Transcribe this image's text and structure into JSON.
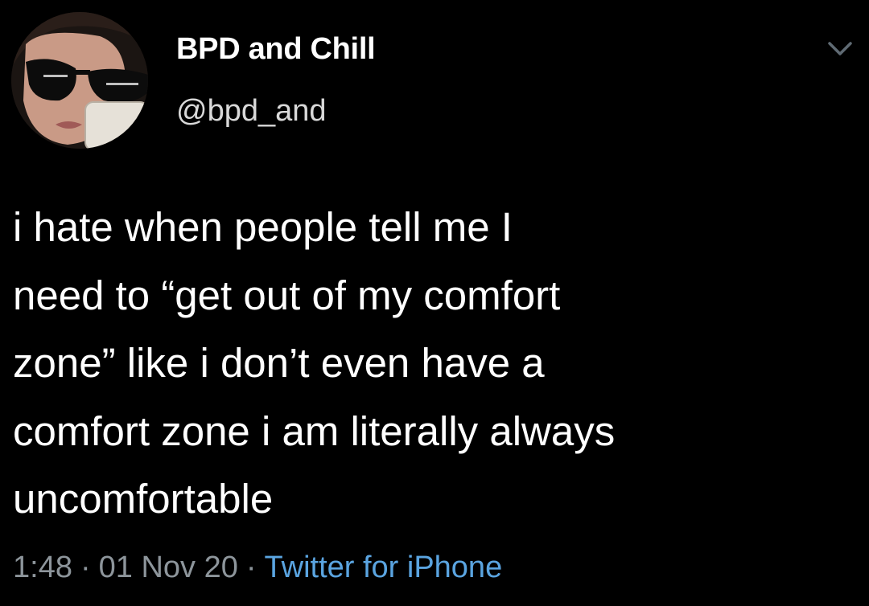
{
  "tweet": {
    "author": {
      "display_name": "BPD and Chill",
      "handle": "@bpd_and",
      "avatar_icon": "profile-photo"
    },
    "body_lines": [
      "i hate when people tell me I",
      "need to “get out of my comfort",
      "zone” like i don’t even have a",
      "comfort zone i am literally always",
      "uncomfortable"
    ],
    "meta": {
      "time": "1:48",
      "separator": "·",
      "date": "01 Nov 20",
      "source": "Twitter for iPhone"
    },
    "menu_icon": "chevron-down-icon"
  },
  "colors": {
    "background": "#000000",
    "text": "#ffffff",
    "secondary_text": "#8d959b",
    "link": "#5aa4e0"
  }
}
